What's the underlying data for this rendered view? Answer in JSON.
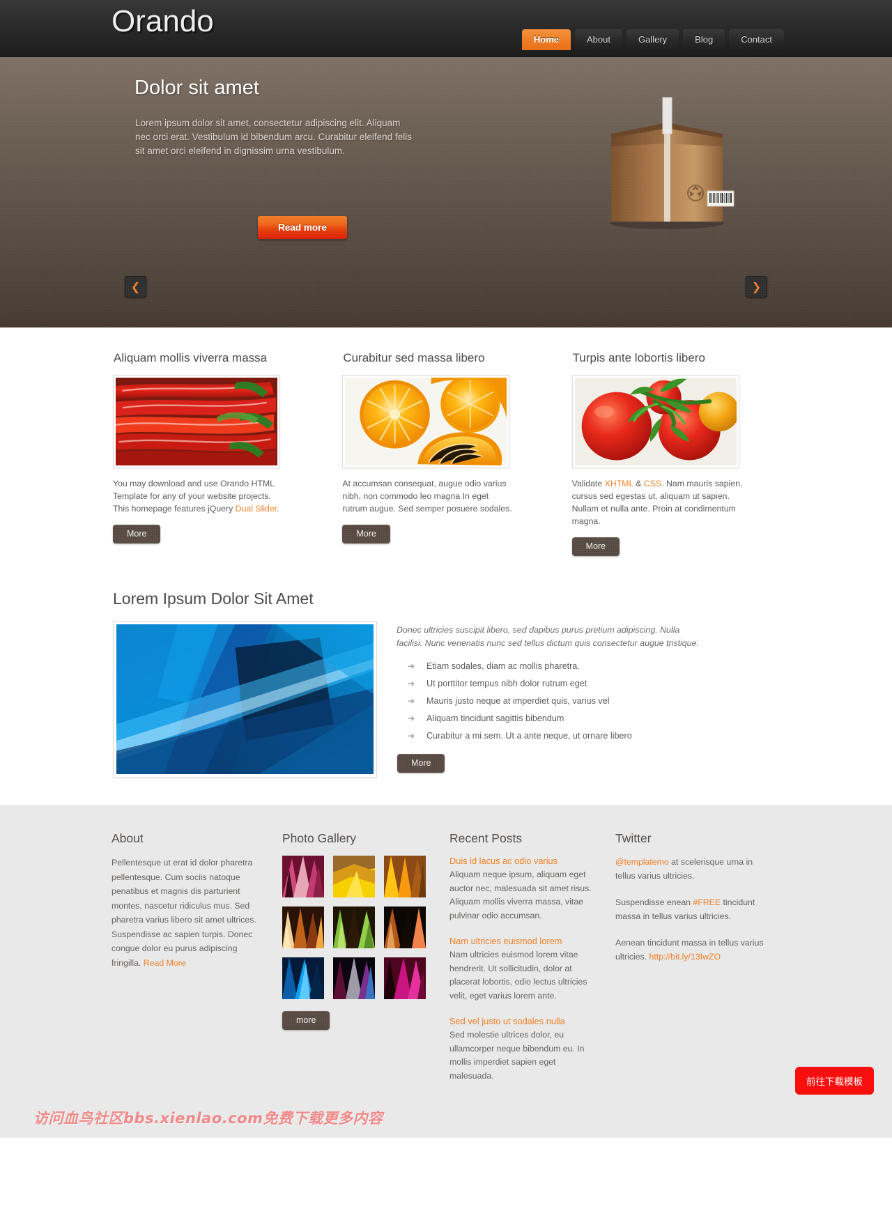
{
  "header": {
    "logo": "Orando",
    "nav": [
      {
        "label": "Home",
        "active": true
      },
      {
        "label": "About",
        "active": false
      },
      {
        "label": "Gallery",
        "active": false
      },
      {
        "label": "Blog",
        "active": false
      },
      {
        "label": "Contact",
        "active": false
      }
    ]
  },
  "hero": {
    "title": "Dolor sit amet",
    "description": "Lorem ipsum dolor sit amet, consectetur adipiscing elit. Aliquam nec orci erat. Vestibulum id bibendum arcu. Curabitur eleifend felis sit amet orci eleifend in dignissim urna vestibulum.",
    "cta": "Read more",
    "prev_glyph": "❮",
    "next_glyph": "❯",
    "image_alt": "cardboard-box"
  },
  "columns": [
    {
      "title": "Aliquam mollis viverra massa",
      "text_before": "You may download and use Orando HTML Template for any of your website projects. This homepage features jQuery ",
      "link": "Dual Slider",
      "text_after": ".",
      "button": "More",
      "image_alt": "red-chili-peppers"
    },
    {
      "title": "Curabitur sed massa libero",
      "text_before": "At accumsan consequat, augue odio varius nibh, non commodo leo magna  In eget rutrum augue. Sed semper posuere sodales.",
      "link": "",
      "text_after": "",
      "button": "More",
      "image_alt": "sliced-oranges"
    },
    {
      "title": "Turpis ante lobortis libero",
      "text_before": "Validate ",
      "link": "XHTML",
      "text_mid": " & ",
      "link2": "CSS",
      "text_after": ". Nam mauris sapien, cursus sed egestas ut, aliquam ut sapien. Nullam et nulla ante. Proin at condimentum magna.",
      "button": "More",
      "image_alt": "red-tomatoes"
    }
  ],
  "feature": {
    "title": "Lorem Ipsum Dolor Sit Amet",
    "lead": "Donec ultricies suscipit libero, sed dapibus purus pretium adipiscing. Nulla facilisi. Nunc venenatis nunc sed tellus dictum quis consectetur augue tristique.",
    "bullet_glyph": "➔",
    "items": [
      "Etiam sodales, diam ac mollis pharetra.",
      "Ut porttitor tempus nibh dolor rutrum eget",
      "Mauris justo neque at imperdiet quis, varius vel",
      "Aliquam tincidunt sagittis bibendum",
      "Curabitur a mi sem. Ut a ante neque, ut ornare libero"
    ],
    "button": "More",
    "image_alt": "blue-abstract-geometry"
  },
  "footer": {
    "about": {
      "title": "About",
      "text": "Pellentesque ut erat id dolor pharetra pellentesque. Cum sociis natoque penatibus et magnis dis parturient montes, nascetur ridiculus mus. Sed pharetra varius libero sit amet ultrices. Suspendisse ac sapien turpis. Donec congue dolor eu purus adipiscing fringilla. ",
      "link": "Read More"
    },
    "gallery": {
      "title": "Photo Gallery",
      "button": "more",
      "thumbs": [
        "thumb-magenta-crystal",
        "thumb-amber-gold",
        "thumb-orange-yellow",
        "thumb-copper-fire",
        "thumb-green-leaf",
        "thumb-dark-ember",
        "thumb-blue-beam",
        "thumb-violet-night",
        "thumb-pink-rose"
      ]
    },
    "posts": {
      "title": "Recent Posts",
      "items": [
        {
          "title": "Duis id lacus ac odio varius",
          "body": "Aliquam neque ipsum, aliquam eget auctor nec, malesuada sit amet risus. Aliquam mollis viverra massa, vitae pulvinar odio accumsan."
        },
        {
          "title": "Nam ultricies euismod lorem",
          "body": "Nam ultricies euismod lorem vitae hendrerit. Ut sollicitudin, dolor at placerat lobortis, odio lectus ultricies velit, eget varius lorem ante."
        },
        {
          "title": "Sed vel justo ut sodales nulla",
          "body": "Sed molestie ultrices dolor, eu ullamcorper neque bibendum eu. In mollis imperdiet sapien eget malesuada."
        }
      ]
    },
    "twitter": {
      "title": "Twitter",
      "tweets": [
        {
          "handle": "@templatemo",
          "text": " at scelerisque urna in tellus varius ultricies."
        },
        {
          "pre": "Suspendisse enean ",
          "tag": "#FREE",
          "text": " tincidunt massa in tellus varius ultricies."
        },
        {
          "pre": "Aenean tincidunt massa in tellus varius ultricies. ",
          "url": "http://bit.ly/13IwZO",
          "text": ""
        }
      ]
    }
  },
  "overlay": {
    "watermark": "访问血鸟社区bbs.xienlao.com免费下载更多内容",
    "download_button": "前往下载模板"
  },
  "colors": {
    "accent": "#ef7f25",
    "header_bg": "#2b2b2b",
    "hero_bg": "#5a4e45",
    "footer_bg": "#e9e9e9",
    "cta_red": "#dd1f05",
    "download_red": "#fa0f0f",
    "watermark_pink": "#f08a8a"
  }
}
